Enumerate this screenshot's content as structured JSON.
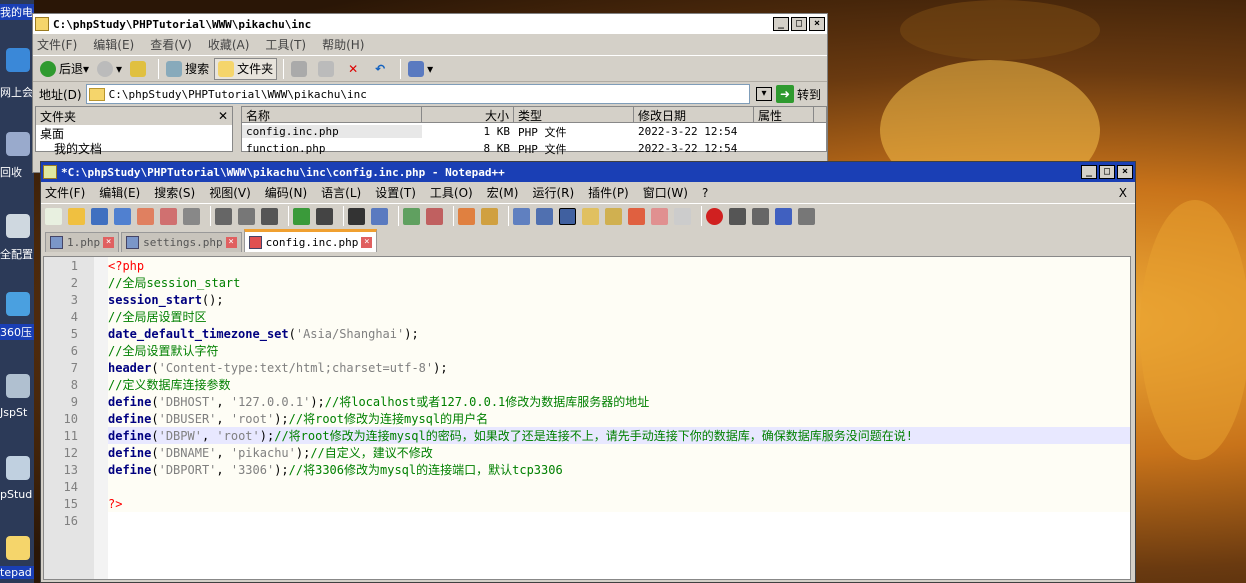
{
  "desktop": {
    "labels": [
      "我的电脑",
      "网上会",
      "回收",
      "全配置",
      "360压",
      "JspSt",
      "pStud 手册",
      "tepad"
    ]
  },
  "explorer": {
    "title": "C:\\phpStudy\\PHPTutorial\\WWW\\pikachu\\inc",
    "menu": [
      "文件(F)",
      "编辑(E)",
      "查看(V)",
      "收藏(A)",
      "工具(T)",
      "帮助(H)"
    ],
    "toolbar": {
      "back": "后退",
      "search": "搜索",
      "folders": "文件夹"
    },
    "address_label": "地址(D)",
    "address_value": "C:\\phpStudy\\PHPTutorial\\WWW\\pikachu\\inc",
    "go_label": "转到",
    "folders_pane": {
      "header": "文件夹",
      "items": [
        "桌面",
        "我的文档"
      ]
    },
    "columns": [
      "名称",
      "大小",
      "类型",
      "修改日期",
      "属性"
    ],
    "files": [
      {
        "name": "config.inc.php",
        "size": "1 KB",
        "type": "PHP 文件",
        "date": "2022-3-22 12:54"
      },
      {
        "name": "function.php",
        "size": "8 KB",
        "type": "PHP 文件",
        "date": "2022-3-22 12:54"
      }
    ]
  },
  "npp": {
    "title": "*C:\\phpStudy\\PHPTutorial\\WWW\\pikachu\\inc\\config.inc.php - Notepad++",
    "menu": [
      "文件(F)",
      "编辑(E)",
      "搜索(S)",
      "视图(V)",
      "编码(N)",
      "语言(L)",
      "设置(T)",
      "工具(O)",
      "宏(M)",
      "运行(R)",
      "插件(P)",
      "窗口(W)",
      "?"
    ],
    "close_x": "X",
    "tabs": [
      "1.php",
      "settings.php",
      "config.inc.php"
    ],
    "active_tab": 2,
    "lines": [
      {
        "n": "1",
        "t": [
          [
            "php",
            "<?php"
          ]
        ]
      },
      {
        "n": "2",
        "t": [
          [
            "cm",
            "//全局session_start"
          ]
        ]
      },
      {
        "n": "3",
        "t": [
          [
            "kw",
            "session_start"
          ],
          [
            "",
            "();"
          ]
        ]
      },
      {
        "n": "4",
        "t": [
          [
            "cm",
            "//全局居设置时区"
          ]
        ]
      },
      {
        "n": "5",
        "t": [
          [
            "kw",
            "date_default_timezone_set"
          ],
          [
            "",
            "("
          ],
          [
            "str",
            "'Asia/Shanghai'"
          ],
          [
            "",
            ");"
          ]
        ]
      },
      {
        "n": "6",
        "t": [
          [
            "cm",
            "//全局设置默认字符"
          ]
        ]
      },
      {
        "n": "7",
        "t": [
          [
            "kw",
            "header"
          ],
          [
            "",
            "("
          ],
          [
            "str",
            "'Content-type:text/html;charset=utf-8'"
          ],
          [
            "",
            ");"
          ]
        ]
      },
      {
        "n": "8",
        "t": [
          [
            "cm",
            "//定义数据库连接参数"
          ]
        ]
      },
      {
        "n": "9",
        "t": [
          [
            "kw",
            "define"
          ],
          [
            "",
            "("
          ],
          [
            "str",
            "'DBHOST'"
          ],
          [
            "",
            ", "
          ],
          [
            "str",
            "'127.0.0.1'"
          ],
          [
            "",
            ");"
          ],
          [
            "cm",
            "//将localhost或者127.0.0.1修改为数据库服务器的地址"
          ]
        ]
      },
      {
        "n": "10",
        "t": [
          [
            "kw",
            "define"
          ],
          [
            "",
            "("
          ],
          [
            "str",
            "'DBUSER'"
          ],
          [
            "",
            ", "
          ],
          [
            "str",
            "'root'"
          ],
          [
            "",
            ");"
          ],
          [
            "cm",
            "//将root修改为连接mysql的用户名"
          ]
        ]
      },
      {
        "n": "11",
        "t": [
          [
            "kw",
            "define"
          ],
          [
            "",
            "("
          ],
          [
            "str",
            "'DBPW'"
          ],
          [
            "",
            ", "
          ],
          [
            "str",
            "'root'"
          ],
          [
            "",
            ");"
          ],
          [
            "cm",
            "//将root修改为连接mysql的密码，如果改了还是连接不上，请先手动连接下你的数据库，确保数据库服务没问题在说!"
          ]
        ],
        "hl": true
      },
      {
        "n": "12",
        "t": [
          [
            "kw",
            "define"
          ],
          [
            "",
            "("
          ],
          [
            "str",
            "'DBNAME'"
          ],
          [
            "",
            ", "
          ],
          [
            "str",
            "'pikachu'"
          ],
          [
            "",
            ");"
          ],
          [
            "cm",
            "//自定义，建议不修改"
          ]
        ]
      },
      {
        "n": "13",
        "t": [
          [
            "kw",
            "define"
          ],
          [
            "",
            "("
          ],
          [
            "str",
            "'DBPORT'"
          ],
          [
            "",
            ", "
          ],
          [
            "str",
            "'3306'"
          ],
          [
            "",
            ");"
          ],
          [
            "cm",
            "//将3306修改为mysql的连接端口，默认tcp3306"
          ]
        ]
      },
      {
        "n": "14",
        "t": []
      },
      {
        "n": "15",
        "t": [
          [
            "php",
            "?>"
          ]
        ]
      },
      {
        "n": "16",
        "t": [],
        "blank": true
      }
    ]
  }
}
